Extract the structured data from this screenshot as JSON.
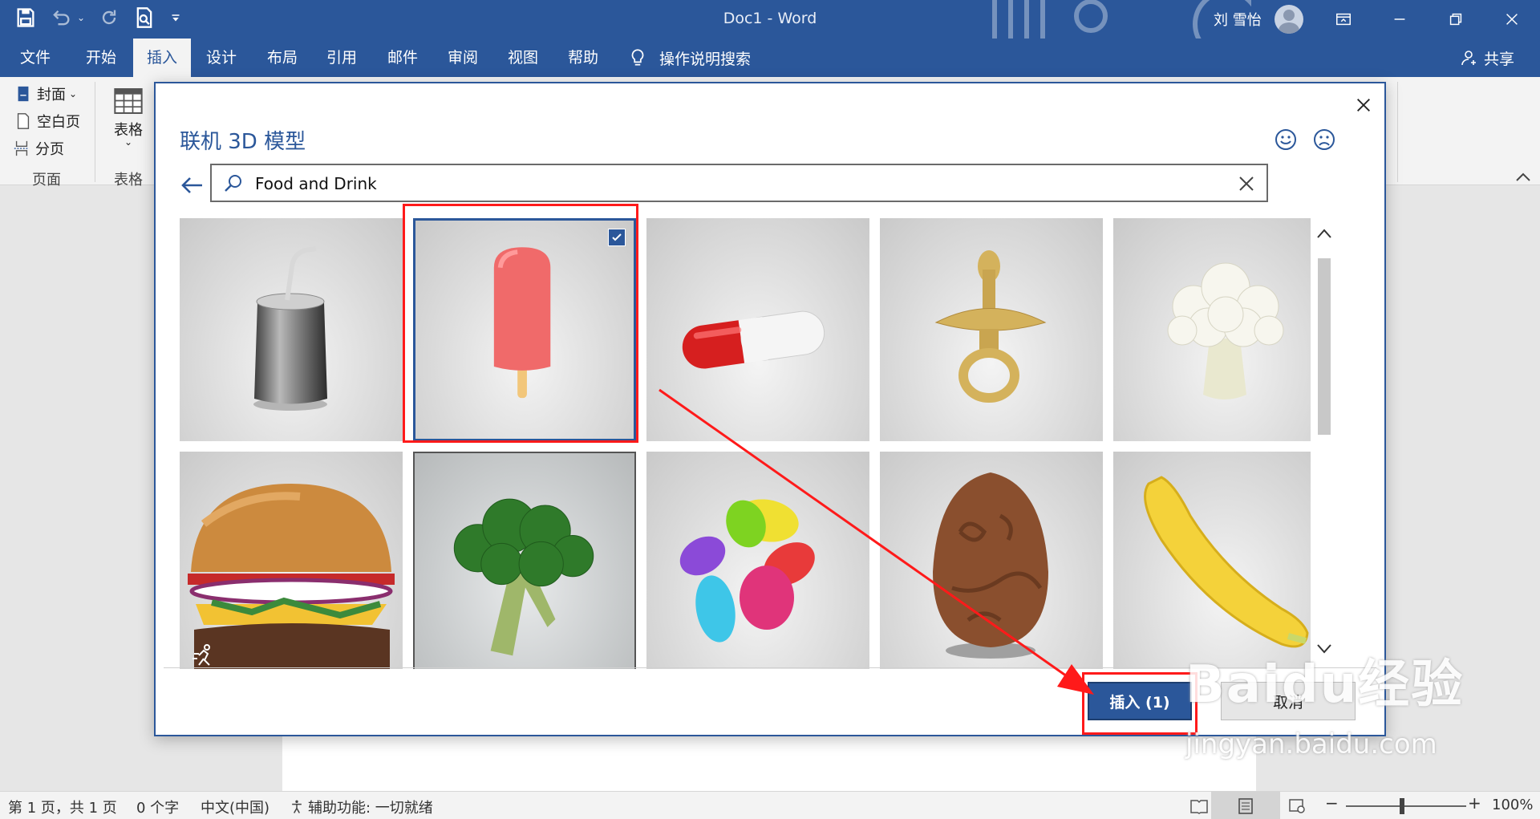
{
  "app": {
    "document_name": "Doc1 - Word",
    "user_name": "刘 雪怡"
  },
  "tabs": [
    "文件",
    "开始",
    "插入",
    "设计",
    "布局",
    "引用",
    "邮件",
    "审阅",
    "视图",
    "帮助"
  ],
  "active_tab": "插入",
  "tell_me": "操作说明搜索",
  "share_label": "共享",
  "ribbon": {
    "pages_group": {
      "label": "页面",
      "items": [
        "封面",
        "空白页",
        "分页"
      ]
    },
    "table_group": {
      "label": "表格",
      "button": "表格"
    }
  },
  "dialog": {
    "title": "联机 3D 模型",
    "search": {
      "value": "Food and Drink"
    },
    "models": [
      {
        "name": "soda-can",
        "selected": false
      },
      {
        "name": "popsicle",
        "selected": true
      },
      {
        "name": "pill-capsule",
        "selected": false
      },
      {
        "name": "pacifier",
        "selected": false
      },
      {
        "name": "cauliflower",
        "selected": false
      },
      {
        "name": "hamburger",
        "selected": false,
        "animated": true
      },
      {
        "name": "broccoli",
        "selected": false
      },
      {
        "name": "jelly-beans",
        "selected": false
      },
      {
        "name": "chocolate-egg",
        "selected": false
      },
      {
        "name": "banana",
        "selected": false
      }
    ],
    "insert_label": "插入 (1)",
    "cancel_label": "取消"
  },
  "status": {
    "page": "第 1 页，共 1 页",
    "words": "0 个字",
    "language": "中文(中国)",
    "accessibility": "辅助功能: 一切就绪",
    "zoom": "100%"
  },
  "watermark": {
    "brand": "Baidu经验",
    "url": "jingyan.baidu.com"
  },
  "colors": {
    "word_blue": "#2b579a",
    "highlight_red": "#ff1a1a"
  }
}
